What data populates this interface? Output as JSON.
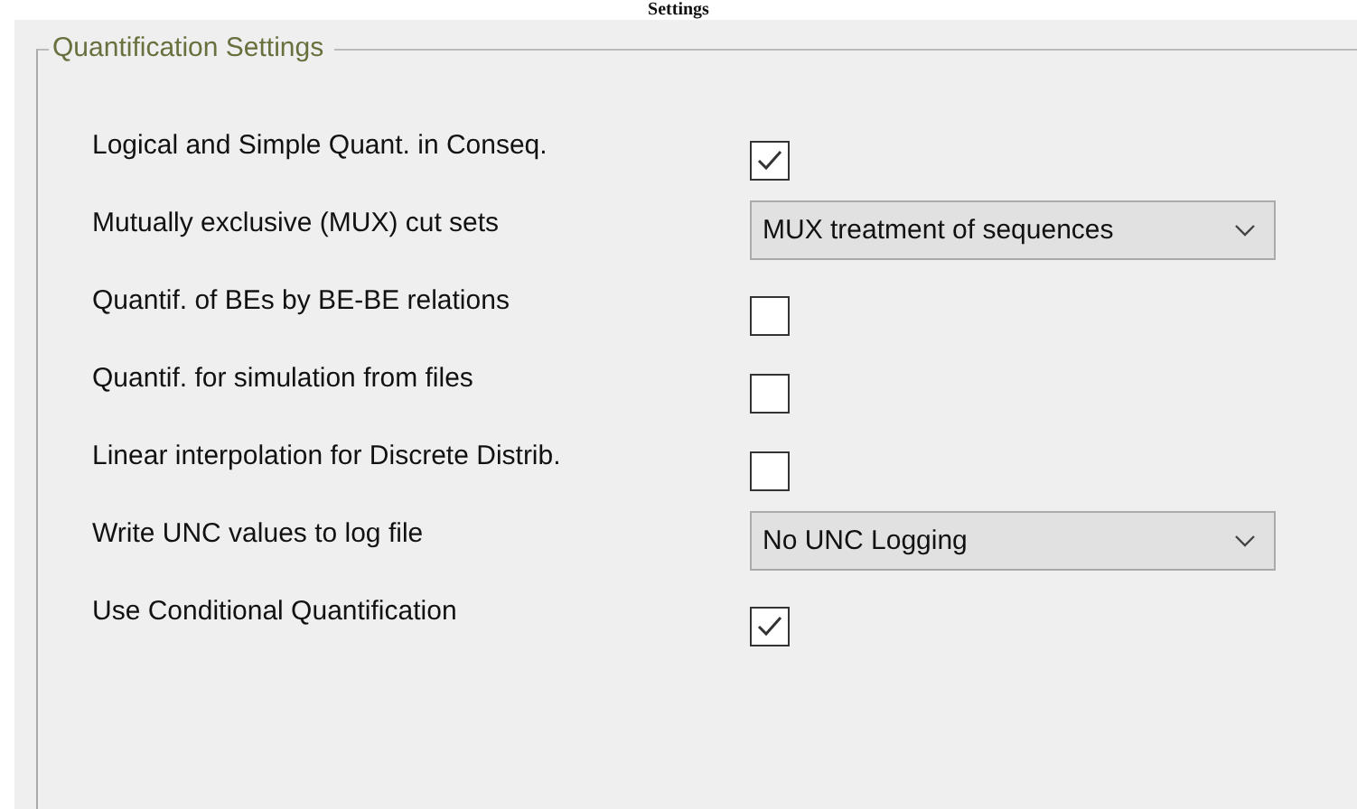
{
  "page_title": "Settings",
  "group": {
    "title": "Quantification Settings",
    "rows": [
      {
        "label": "Logical and Simple Quant. in Conseq.",
        "kind": "checkbox",
        "checked": true
      },
      {
        "label": "Mutually exclusive (MUX) cut sets",
        "kind": "dropdown",
        "value": "MUX treatment of sequences"
      },
      {
        "label": "Quantif. of BEs by BE-BE relations",
        "kind": "checkbox",
        "checked": false
      },
      {
        "label": "Quantif. for simulation from files",
        "kind": "checkbox",
        "checked": false
      },
      {
        "label": "Linear interpolation for Discrete Distrib.",
        "kind": "checkbox",
        "checked": false
      },
      {
        "label": "Write UNC values to log file",
        "kind": "dropdown",
        "value": "No UNC Logging"
      },
      {
        "label": "Use Conditional Quantification",
        "kind": "checkbox",
        "checked": true
      }
    ]
  }
}
